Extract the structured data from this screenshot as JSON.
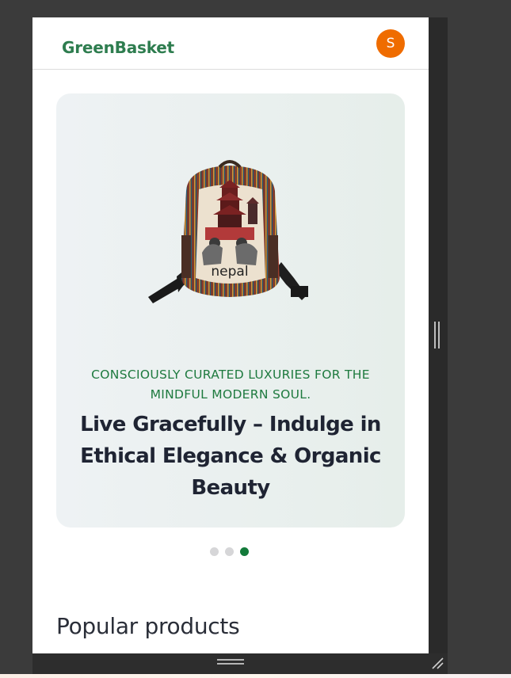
{
  "brand": {
    "name": "GreenBasket",
    "color": "#2e7d4f"
  },
  "user": {
    "avatar_initial": "S",
    "avatar_color": "#ef6c00"
  },
  "hero": {
    "image_subject": "nepal-backpack",
    "image_text": "nepal",
    "tagline": "CONSCIOUSLY CURATED LUXURIES FOR THE MINDFUL MODERN SOUL.",
    "headline": "Live Gracefully – Indulge in Ethical Elegance & Organic Beauty",
    "tagline_color": "#1e7a3f"
  },
  "carousel": {
    "slide_count": 3,
    "active_index": 2,
    "active_color": "#137a3a"
  },
  "sections": {
    "popular_title": "Popular products"
  }
}
